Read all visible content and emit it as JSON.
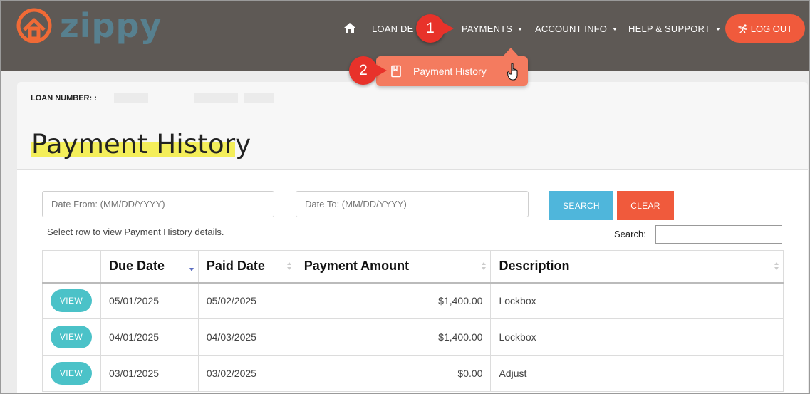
{
  "brand": {
    "name": "zippy",
    "accent": "#f05a3c",
    "logo_color": "#57808f"
  },
  "nav": {
    "items": [
      {
        "label": "LOAN DE"
      },
      {
        "label": "PAYMENTS"
      },
      {
        "label": "ACCOUNT INFO"
      },
      {
        "label": "HELP & SUPPORT"
      }
    ],
    "logout_label": "LOG OUT"
  },
  "callouts": {
    "step1": "1",
    "step2": "2"
  },
  "dropdown": {
    "item": "Payment History"
  },
  "page": {
    "loan_label": "LOAN NUMBER: :",
    "title_highlighted": "Payment Histor",
    "title_rest": "y"
  },
  "filters": {
    "date_from_placeholder": "Date From: (MM/DD/YYYY)",
    "date_to_placeholder": "Date To: (MM/DD/YYYY)",
    "search_button": "SEARCH",
    "clear_button": "CLEAR",
    "hint": "Select row to view Payment History details.",
    "search_label": "Search:"
  },
  "table": {
    "headers": [
      "",
      "Due Date",
      "Paid Date",
      "Payment Amount",
      "Description"
    ],
    "view_label": "VIEW",
    "rows": [
      {
        "due": "05/01/2025",
        "paid": "05/02/2025",
        "amount": "$1,400.00",
        "description": "Lockbox"
      },
      {
        "due": "04/01/2025",
        "paid": "04/03/2025",
        "amount": "$1,400.00",
        "description": "Lockbox"
      },
      {
        "due": "03/01/2025",
        "paid": "03/02/2025",
        "amount": "$0.00",
        "description": "Adjust"
      }
    ]
  }
}
